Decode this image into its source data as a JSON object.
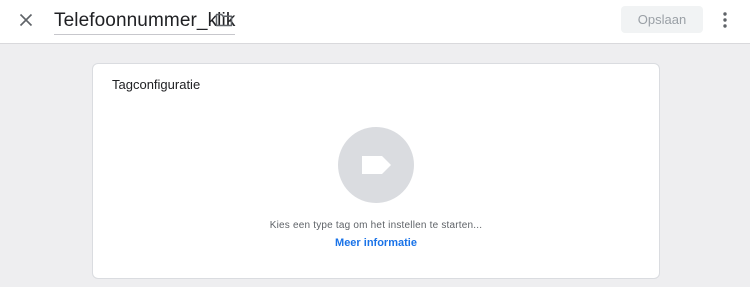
{
  "topbar": {
    "close_icon": "close-icon",
    "title": "Telefoonnummer_klik",
    "folder_icon": "folder-icon",
    "save_label": "Opslaan",
    "more_icon": "more-vert-icon"
  },
  "card": {
    "title": "Tagconfiguratie",
    "tag_icon": "tag-icon",
    "hint": "Kies een type tag om het instellen te starten...",
    "link": "Meer informatie"
  },
  "colors": {
    "link": "#1a73e8",
    "page_bg": "#eeeef0",
    "tag_circle": "#dadce0"
  }
}
